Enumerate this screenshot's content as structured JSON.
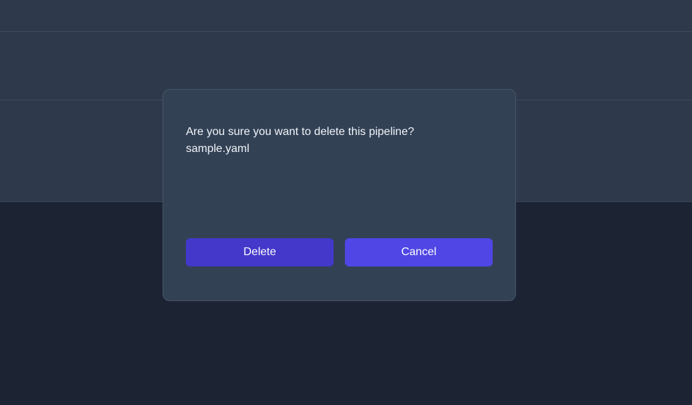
{
  "dialog": {
    "message": "Are you sure you want to delete this pipeline?",
    "filename": "sample.yaml",
    "delete_label": "Delete",
    "cancel_label": "Cancel"
  },
  "colors": {
    "page_background": "#1c2333",
    "panel_background": "#2e394b",
    "dialog_background": "#334155",
    "delete_button": "#4338ca",
    "cancel_button": "#4f46e5"
  }
}
